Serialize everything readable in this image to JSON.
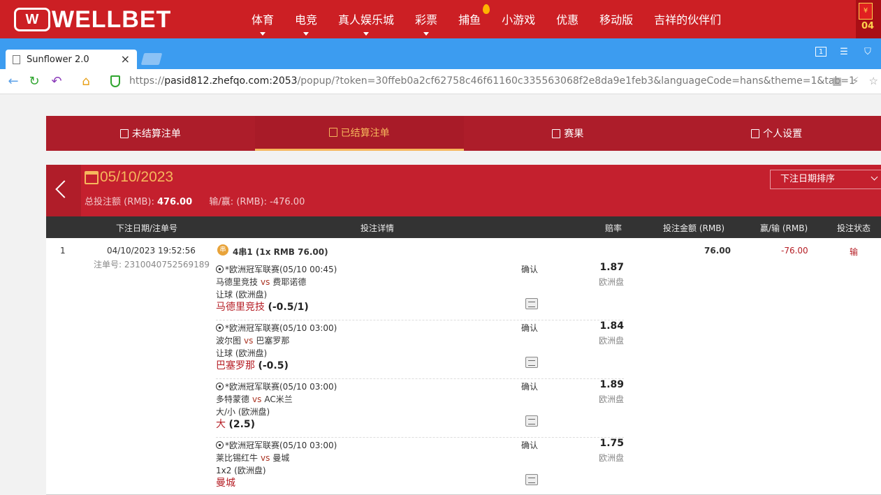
{
  "site": {
    "logo_mark": "W",
    "logo_text": "WELLBET",
    "nav": [
      {
        "label": "体育",
        "caret": true
      },
      {
        "label": "电竞",
        "caret": true
      },
      {
        "label": "真人娱乐城",
        "caret": true
      },
      {
        "label": "彩票",
        "caret": true
      },
      {
        "label": "捕鱼",
        "caret": false,
        "hot": true
      },
      {
        "label": "小游戏",
        "caret": false
      },
      {
        "label": "优惠",
        "caret": false
      },
      {
        "label": "移动版",
        "caret": false
      },
      {
        "label": "吉祥的伙伴们",
        "caret": false
      }
    ],
    "promo_number": "04",
    "promo_symbol": "¥"
  },
  "browser": {
    "tab_title": "Sunflower 2.0",
    "url_prefix": "https://",
    "url_host": "pasid812.zhefqo.com:2053",
    "url_path": "/popup/?token=30ffeb0a2cf62758c46f61160c335563068f2e8da9e1feb3&languageCode=hans&theme=1&tab=1",
    "toolbar_box_label": "1"
  },
  "menu": {
    "tabs": [
      {
        "label": "未结算注单",
        "active": false
      },
      {
        "label": "已结算注单",
        "active": true
      },
      {
        "label": "赛果",
        "active": false
      },
      {
        "label": "个人设置",
        "active": false
      }
    ]
  },
  "summary": {
    "date": "05/10/2023",
    "total_label": "总投注额 (RMB):",
    "total_value": "476.00",
    "winloss_label": "输/赢: (RMB):",
    "winloss_value": "-476.00",
    "sort_label": "下注日期排序"
  },
  "table": {
    "headers": {
      "date": "下注日期/注单号",
      "detail": "投注详情",
      "odds": "赔率",
      "stake": "投注金额 (RMB)",
      "winloss": "赢/输 (RMB)",
      "status": "投注状态"
    },
    "row": {
      "index": "1",
      "datetime": "04/10/2023 19:52:56",
      "ticket_label": "注单号:",
      "ticket_no": "2310040752569189",
      "parlay_icon": "串",
      "parlay": "4串1 (1x RMB 76.00)",
      "stake": "76.00",
      "winloss": "-76.00",
      "status": "输",
      "legs": [
        {
          "league": "*欧洲冠军联赛(05/10 00:45)",
          "home": "马德里竞技",
          "away": "费耶诺德",
          "market": "让球 (欧洲盘)",
          "pick": "马德里竞技",
          "line": "(-0.5/1)",
          "confirm": "确认",
          "odds": "1.87",
          "odds_type": "欧洲盘"
        },
        {
          "league": "*欧洲冠军联赛(05/10 03:00)",
          "home": "波尔图",
          "away": "巴塞罗那",
          "market": "让球 (欧洲盘)",
          "pick": "巴塞罗那",
          "line": "(-0.5)",
          "confirm": "确认",
          "odds": "1.84",
          "odds_type": "欧洲盘"
        },
        {
          "league": "*欧洲冠军联赛(05/10 03:00)",
          "home": "多特蒙德",
          "away": "AC米兰",
          "market": "大/小 (欧洲盘)",
          "pick": "大",
          "line": "(2.5)",
          "confirm": "确认",
          "odds": "1.89",
          "odds_type": "欧洲盘"
        },
        {
          "league": "*欧洲冠军联赛(05/10 03:00)",
          "home": "莱比锡红牛",
          "away": "曼城",
          "market": "1x2 (欧洲盘)",
          "pick": "曼城",
          "line": "",
          "confirm": "确认",
          "odds": "1.75",
          "odds_type": "欧洲盘"
        }
      ],
      "vs": "vs"
    }
  },
  "colors": {
    "site_red": "#cc1f24",
    "browser_blue": "#3c9cf0",
    "menu_red": "#ad1d2a",
    "accent_gold": "#f6b75c",
    "loss_red": "#b51d24"
  }
}
